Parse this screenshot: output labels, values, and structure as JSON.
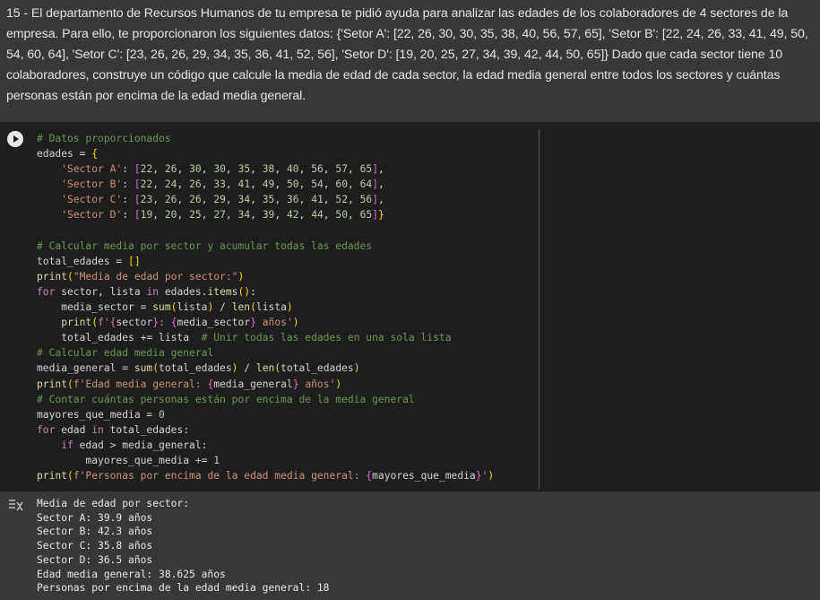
{
  "text_cell": {
    "paragraph": "15 - El departamento de Recursos Humanos de tu empresa te pidió ayuda para analizar las edades de los colaboradores de 4 sectores de la empresa. Para ello, te proporcionaron los siguientes datos: {'Setor A': [22, 26, 30, 30, 35, 38, 40, 56, 57, 65], 'Setor B': [22, 24, 26, 33, 41, 49, 50, 54, 60, 64], 'Setor C': [23, 26, 26, 29, 34, 35, 36, 41, 52, 56], 'Setor D': [19, 20, 25, 27, 34, 39, 42, 44, 50, 65]} Dado que cada sector tiene 10 colaboradores, construye un código que calcule la media de edad de cada sector, la edad media general entre todos los sectores y cuántas personas están por encima de la edad media general."
  },
  "code_cell": {
    "lines": [
      [
        {
          "t": "# Datos proporcionados",
          "c": "com"
        }
      ],
      [
        {
          "t": "edades = ",
          "c": "var"
        },
        {
          "t": "{",
          "c": "br"
        }
      ],
      [
        {
          "t": "    ",
          "c": "var"
        },
        {
          "t": "'Sector A'",
          "c": "str"
        },
        {
          "t": ": ",
          "c": "var"
        },
        {
          "t": "[",
          "c": "br2"
        },
        {
          "t": "22",
          "c": "num"
        },
        {
          "t": ", ",
          "c": "var"
        },
        {
          "t": "26",
          "c": "num"
        },
        {
          "t": ", ",
          "c": "var"
        },
        {
          "t": "30",
          "c": "num"
        },
        {
          "t": ", ",
          "c": "var"
        },
        {
          "t": "30",
          "c": "num"
        },
        {
          "t": ", ",
          "c": "var"
        },
        {
          "t": "35",
          "c": "num"
        },
        {
          "t": ", ",
          "c": "var"
        },
        {
          "t": "38",
          "c": "num"
        },
        {
          "t": ", ",
          "c": "var"
        },
        {
          "t": "40",
          "c": "num"
        },
        {
          "t": ", ",
          "c": "var"
        },
        {
          "t": "56",
          "c": "num"
        },
        {
          "t": ", ",
          "c": "var"
        },
        {
          "t": "57",
          "c": "num"
        },
        {
          "t": ", ",
          "c": "var"
        },
        {
          "t": "65",
          "c": "num"
        },
        {
          "t": "]",
          "c": "br2"
        },
        {
          "t": ",",
          "c": "var"
        }
      ],
      [
        {
          "t": "    ",
          "c": "var"
        },
        {
          "t": "'Sector B'",
          "c": "str"
        },
        {
          "t": ": ",
          "c": "var"
        },
        {
          "t": "[",
          "c": "br2"
        },
        {
          "t": "22",
          "c": "num"
        },
        {
          "t": ", ",
          "c": "var"
        },
        {
          "t": "24",
          "c": "num"
        },
        {
          "t": ", ",
          "c": "var"
        },
        {
          "t": "26",
          "c": "num"
        },
        {
          "t": ", ",
          "c": "var"
        },
        {
          "t": "33",
          "c": "num"
        },
        {
          "t": ", ",
          "c": "var"
        },
        {
          "t": "41",
          "c": "num"
        },
        {
          "t": ", ",
          "c": "var"
        },
        {
          "t": "49",
          "c": "num"
        },
        {
          "t": ", ",
          "c": "var"
        },
        {
          "t": "50",
          "c": "num"
        },
        {
          "t": ", ",
          "c": "var"
        },
        {
          "t": "54",
          "c": "num"
        },
        {
          "t": ", ",
          "c": "var"
        },
        {
          "t": "60",
          "c": "num"
        },
        {
          "t": ", ",
          "c": "var"
        },
        {
          "t": "64",
          "c": "num"
        },
        {
          "t": "]",
          "c": "br2"
        },
        {
          "t": ",",
          "c": "var"
        }
      ],
      [
        {
          "t": "    ",
          "c": "var"
        },
        {
          "t": "'Sector C'",
          "c": "str"
        },
        {
          "t": ": ",
          "c": "var"
        },
        {
          "t": "[",
          "c": "br2"
        },
        {
          "t": "23",
          "c": "num"
        },
        {
          "t": ", ",
          "c": "var"
        },
        {
          "t": "26",
          "c": "num"
        },
        {
          "t": ", ",
          "c": "var"
        },
        {
          "t": "26",
          "c": "num"
        },
        {
          "t": ", ",
          "c": "var"
        },
        {
          "t": "29",
          "c": "num"
        },
        {
          "t": ", ",
          "c": "var"
        },
        {
          "t": "34",
          "c": "num"
        },
        {
          "t": ", ",
          "c": "var"
        },
        {
          "t": "35",
          "c": "num"
        },
        {
          "t": ", ",
          "c": "var"
        },
        {
          "t": "36",
          "c": "num"
        },
        {
          "t": ", ",
          "c": "var"
        },
        {
          "t": "41",
          "c": "num"
        },
        {
          "t": ", ",
          "c": "var"
        },
        {
          "t": "52",
          "c": "num"
        },
        {
          "t": ", ",
          "c": "var"
        },
        {
          "t": "56",
          "c": "num"
        },
        {
          "t": "]",
          "c": "br2"
        },
        {
          "t": ",",
          "c": "var"
        }
      ],
      [
        {
          "t": "    ",
          "c": "var"
        },
        {
          "t": "'Sector D'",
          "c": "str"
        },
        {
          "t": ": ",
          "c": "var"
        },
        {
          "t": "[",
          "c": "br2"
        },
        {
          "t": "19",
          "c": "num"
        },
        {
          "t": ", ",
          "c": "var"
        },
        {
          "t": "20",
          "c": "num"
        },
        {
          "t": ", ",
          "c": "var"
        },
        {
          "t": "25",
          "c": "num"
        },
        {
          "t": ", ",
          "c": "var"
        },
        {
          "t": "27",
          "c": "num"
        },
        {
          "t": ", ",
          "c": "var"
        },
        {
          "t": "34",
          "c": "num"
        },
        {
          "t": ", ",
          "c": "var"
        },
        {
          "t": "39",
          "c": "num"
        },
        {
          "t": ", ",
          "c": "var"
        },
        {
          "t": "42",
          "c": "num"
        },
        {
          "t": ", ",
          "c": "var"
        },
        {
          "t": "44",
          "c": "num"
        },
        {
          "t": ", ",
          "c": "var"
        },
        {
          "t": "50",
          "c": "num"
        },
        {
          "t": ", ",
          "c": "var"
        },
        {
          "t": "65",
          "c": "num"
        },
        {
          "t": "]",
          "c": "br2"
        },
        {
          "t": "}",
          "c": "br"
        }
      ],
      [
        {
          "t": "",
          "c": "var"
        }
      ],
      [
        {
          "t": "# Calcular media por sector y acumular todas las edades",
          "c": "com"
        }
      ],
      [
        {
          "t": "total_edades = ",
          "c": "var"
        },
        {
          "t": "[]",
          "c": "br"
        }
      ],
      [
        {
          "t": "print",
          "c": "fn"
        },
        {
          "t": "(",
          "c": "br"
        },
        {
          "t": "\"Media de edad por sector:\"",
          "c": "str"
        },
        {
          "t": ")",
          "c": "br"
        }
      ],
      [
        {
          "t": "for",
          "c": "kw"
        },
        {
          "t": " sector, lista ",
          "c": "var"
        },
        {
          "t": "in",
          "c": "kw"
        },
        {
          "t": " edades.",
          "c": "var"
        },
        {
          "t": "items",
          "c": "fn"
        },
        {
          "t": "()",
          "c": "br"
        },
        {
          "t": ":",
          "c": "var"
        }
      ],
      [
        {
          "t": "    media_sector = ",
          "c": "var"
        },
        {
          "t": "sum",
          "c": "fn"
        },
        {
          "t": "(",
          "c": "br"
        },
        {
          "t": "lista",
          "c": "var"
        },
        {
          "t": ")",
          "c": "br"
        },
        {
          "t": " / ",
          "c": "var"
        },
        {
          "t": "len",
          "c": "fn"
        },
        {
          "t": "(",
          "c": "br"
        },
        {
          "t": "lista",
          "c": "var"
        },
        {
          "t": ")",
          "c": "br"
        }
      ],
      [
        {
          "t": "    ",
          "c": "var"
        },
        {
          "t": "print",
          "c": "fn"
        },
        {
          "t": "(",
          "c": "br"
        },
        {
          "t": "f'",
          "c": "str"
        },
        {
          "t": "{",
          "c": "br2"
        },
        {
          "t": "sector",
          "c": "var"
        },
        {
          "t": "}",
          "c": "br2"
        },
        {
          "t": ": ",
          "c": "str"
        },
        {
          "t": "{",
          "c": "br2"
        },
        {
          "t": "media_sector",
          "c": "var"
        },
        {
          "t": "}",
          "c": "br2"
        },
        {
          "t": " años'",
          "c": "str"
        },
        {
          "t": ")",
          "c": "br"
        }
      ],
      [
        {
          "t": "    total_edades += lista  ",
          "c": "var"
        },
        {
          "t": "# Unir todas las edades en una sola lista",
          "c": "com"
        }
      ],
      [
        {
          "t": "# Calcular edad media general",
          "c": "com"
        }
      ],
      [
        {
          "t": "media_general = ",
          "c": "var"
        },
        {
          "t": "sum",
          "c": "fn"
        },
        {
          "t": "(",
          "c": "br"
        },
        {
          "t": "total_edades",
          "c": "var"
        },
        {
          "t": ")",
          "c": "br"
        },
        {
          "t": " / ",
          "c": "var"
        },
        {
          "t": "len",
          "c": "fn"
        },
        {
          "t": "(",
          "c": "br"
        },
        {
          "t": "total_edades",
          "c": "var"
        },
        {
          "t": ")",
          "c": "br"
        }
      ],
      [
        {
          "t": "print",
          "c": "fn"
        },
        {
          "t": "(",
          "c": "br"
        },
        {
          "t": "f'Edad media general: ",
          "c": "str"
        },
        {
          "t": "{",
          "c": "br2"
        },
        {
          "t": "media_general",
          "c": "var"
        },
        {
          "t": "}",
          "c": "br2"
        },
        {
          "t": " años'",
          "c": "str"
        },
        {
          "t": ")",
          "c": "br"
        }
      ],
      [
        {
          "t": "# Contar cuántas personas están por encima de la media general",
          "c": "com"
        }
      ],
      [
        {
          "t": "mayores_que_media = ",
          "c": "var"
        },
        {
          "t": "0",
          "c": "num"
        }
      ],
      [
        {
          "t": "for",
          "c": "kw"
        },
        {
          "t": " edad ",
          "c": "var"
        },
        {
          "t": "in",
          "c": "kw"
        },
        {
          "t": " total_edades:",
          "c": "var"
        }
      ],
      [
        {
          "t": "    ",
          "c": "var"
        },
        {
          "t": "if",
          "c": "kw"
        },
        {
          "t": " edad > media_general:",
          "c": "var"
        }
      ],
      [
        {
          "t": "        mayores_que_media += ",
          "c": "var"
        },
        {
          "t": "1",
          "c": "num"
        }
      ],
      [
        {
          "t": "print",
          "c": "fn"
        },
        {
          "t": "(",
          "c": "br"
        },
        {
          "t": "f'Personas por encima de la edad media general: ",
          "c": "str"
        },
        {
          "t": "{",
          "c": "br2"
        },
        {
          "t": "mayores_que_media",
          "c": "var"
        },
        {
          "t": "}",
          "c": "br2"
        },
        {
          "t": "'",
          "c": "str"
        },
        {
          "t": ")",
          "c": "br"
        }
      ]
    ]
  },
  "output": {
    "lines": [
      "Media de edad por sector:",
      "Sector A: 39.9 años",
      "Sector B: 42.3 años",
      "Sector C: 35.8 años",
      "Sector D: 36.5 años",
      "Edad media general: 38.625 años",
      "Personas por encima de la edad media general: 18"
    ]
  },
  "colors": {
    "background": "#383838",
    "code_background": "#1e1e1e",
    "comment": "#6a9955",
    "string": "#ce9178",
    "number": "#b5cea8",
    "keyword": "#c586c0",
    "function": "#dcdcaa"
  },
  "icons": {
    "run": "play-circle-icon",
    "output": "output-toggle-icon"
  }
}
